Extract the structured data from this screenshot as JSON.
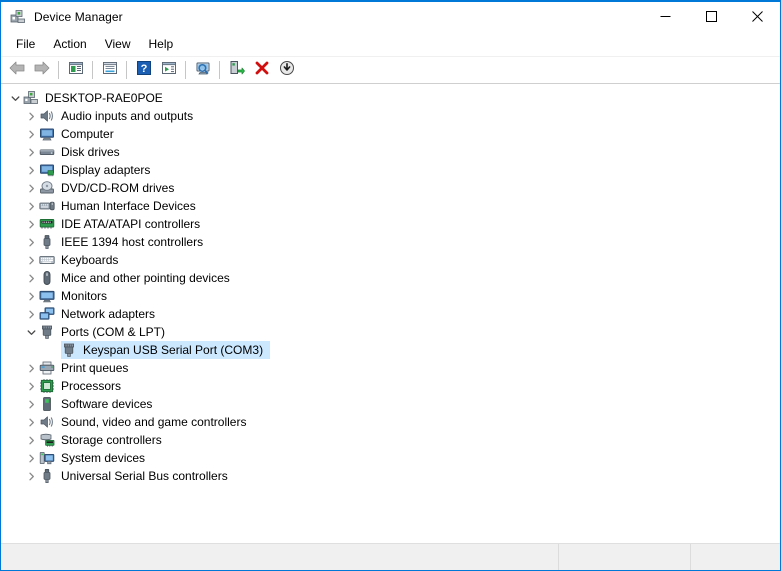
{
  "window": {
    "title": "Device Manager",
    "icon": "device-manager-icon",
    "frame_color": "#0078d7",
    "controls": [
      {
        "name": "minimize-button",
        "glyph": "minimize"
      },
      {
        "name": "maximize-button",
        "glyph": "maximize"
      },
      {
        "name": "close-button",
        "glyph": "close"
      }
    ]
  },
  "menubar": {
    "items": [
      {
        "label": "File"
      },
      {
        "label": "Action"
      },
      {
        "label": "View"
      },
      {
        "label": "Help"
      }
    ]
  },
  "toolbar": {
    "buttons": [
      {
        "name": "back-button",
        "icon": "back-arrow-icon"
      },
      {
        "name": "forward-button",
        "icon": "forward-arrow-icon"
      },
      {
        "sep": true
      },
      {
        "name": "show-hide-console-tree-button",
        "icon": "console-tree-icon"
      },
      {
        "sep": true
      },
      {
        "name": "properties-button",
        "icon": "properties-icon"
      },
      {
        "sep": true
      },
      {
        "name": "help-button",
        "icon": "help-question-icon"
      },
      {
        "name": "show-hide-action-pane-button",
        "icon": "action-pane-icon"
      },
      {
        "sep": true
      },
      {
        "name": "scan-for-hardware-changes-button",
        "icon": "scan-monitor-icon"
      },
      {
        "sep": true
      },
      {
        "name": "update-driver-button",
        "icon": "update-driver-icon"
      },
      {
        "name": "uninstall-device-button",
        "icon": "uninstall-red-x-icon"
      },
      {
        "name": "disable-device-button",
        "icon": "download-circle-icon"
      }
    ]
  },
  "tree": {
    "selection_color": "#cce8ff",
    "nodes": [
      {
        "label": "DESKTOP-RAE0POE",
        "level": 0,
        "state": "expanded",
        "icon": "computer-root-icon",
        "selected": false
      },
      {
        "label": "Audio inputs and outputs",
        "level": 1,
        "state": "collapsed",
        "icon": "speaker-icon",
        "selected": false
      },
      {
        "label": "Computer",
        "level": 1,
        "state": "collapsed",
        "icon": "monitor-icon",
        "selected": false
      },
      {
        "label": "Disk drives",
        "level": 1,
        "state": "collapsed",
        "icon": "disk-drive-icon",
        "selected": false
      },
      {
        "label": "Display adapters",
        "level": 1,
        "state": "collapsed",
        "icon": "display-adapter-icon",
        "selected": false
      },
      {
        "label": "DVD/CD-ROM drives",
        "level": 1,
        "state": "collapsed",
        "icon": "optical-drive-icon",
        "selected": false
      },
      {
        "label": "Human Interface Devices",
        "level": 1,
        "state": "collapsed",
        "icon": "hid-icon",
        "selected": false
      },
      {
        "label": "IDE ATA/ATAPI controllers",
        "level": 1,
        "state": "collapsed",
        "icon": "ide-controller-icon",
        "selected": false
      },
      {
        "label": "IEEE 1394 host controllers",
        "level": 1,
        "state": "collapsed",
        "icon": "firewire-icon",
        "selected": false
      },
      {
        "label": "Keyboards",
        "level": 1,
        "state": "collapsed",
        "icon": "keyboard-icon",
        "selected": false
      },
      {
        "label": "Mice and other pointing devices",
        "level": 1,
        "state": "collapsed",
        "icon": "mouse-icon",
        "selected": false
      },
      {
        "label": "Monitors",
        "level": 1,
        "state": "collapsed",
        "icon": "monitor-screen-icon",
        "selected": false
      },
      {
        "label": "Network adapters",
        "level": 1,
        "state": "collapsed",
        "icon": "network-adapter-icon",
        "selected": false
      },
      {
        "label": "Ports (COM & LPT)",
        "level": 1,
        "state": "expanded",
        "icon": "port-icon",
        "selected": false
      },
      {
        "label": "Keyspan USB Serial Port (COM3)",
        "level": 2,
        "state": "leaf",
        "icon": "port-icon",
        "selected": true
      },
      {
        "label": "Print queues",
        "level": 1,
        "state": "collapsed",
        "icon": "printer-icon",
        "selected": false
      },
      {
        "label": "Processors",
        "level": 1,
        "state": "collapsed",
        "icon": "processor-icon",
        "selected": false
      },
      {
        "label": "Software devices",
        "level": 1,
        "state": "collapsed",
        "icon": "software-device-icon",
        "selected": false
      },
      {
        "label": "Sound, video and game controllers",
        "level": 1,
        "state": "collapsed",
        "icon": "speaker-icon",
        "selected": false
      },
      {
        "label": "Storage controllers",
        "level": 1,
        "state": "collapsed",
        "icon": "storage-controller-icon",
        "selected": false
      },
      {
        "label": "System devices",
        "level": 1,
        "state": "collapsed",
        "icon": "system-device-icon",
        "selected": false
      },
      {
        "label": "Universal Serial Bus controllers",
        "level": 1,
        "state": "collapsed",
        "icon": "usb-icon",
        "selected": false
      }
    ]
  },
  "statusbar": {
    "pane1": "",
    "pane2": "",
    "pane3": ""
  }
}
